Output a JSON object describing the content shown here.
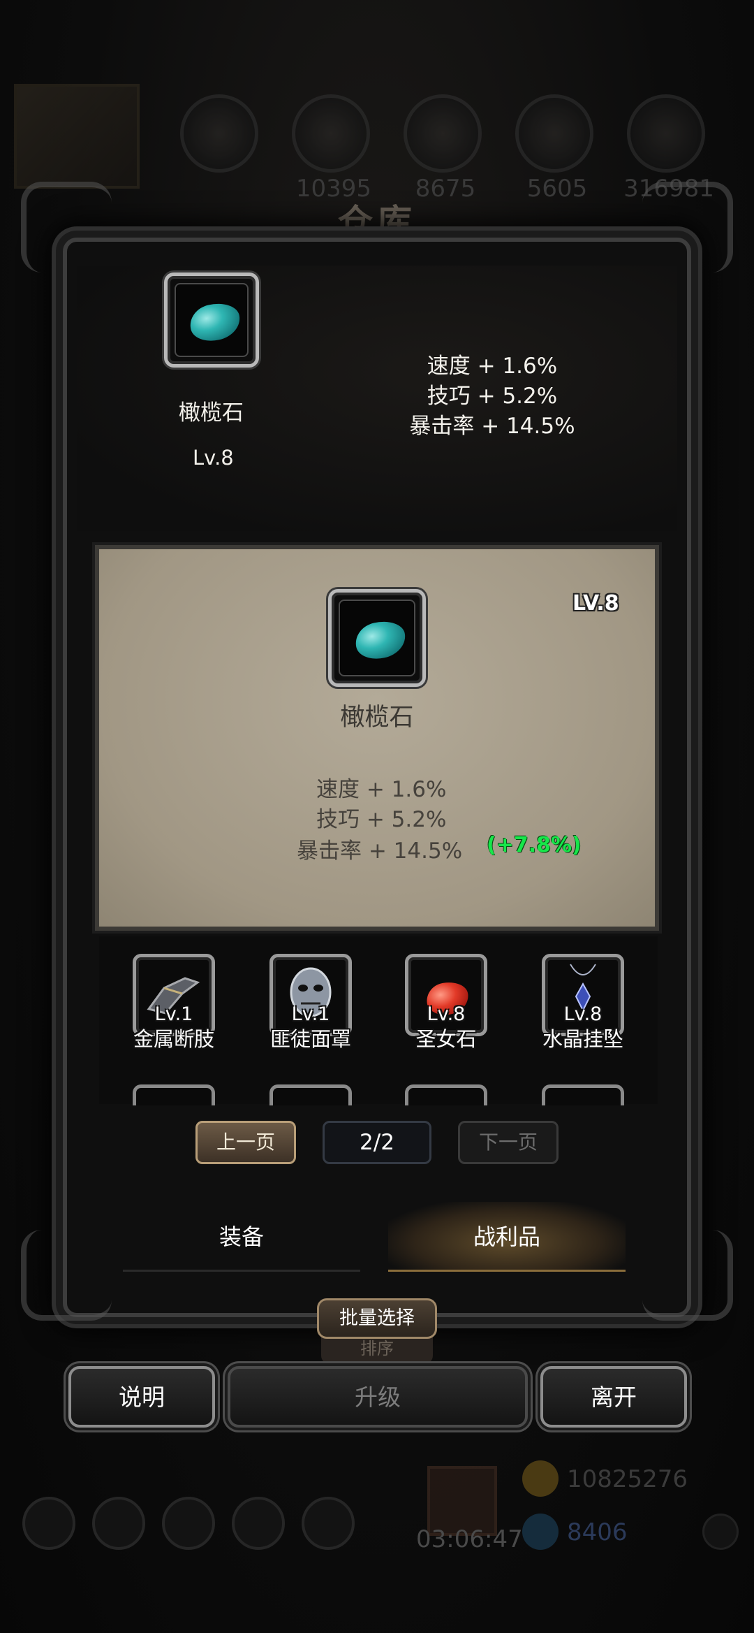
{
  "background": {
    "title": "仓库",
    "top_resources": [
      "10395",
      "8675",
      "5605",
      "316981"
    ],
    "gold": "10825276",
    "gems": "8406",
    "timer": "03:06:47"
  },
  "selected_item": {
    "name": "橄榄石",
    "level": "Lv.8",
    "stats": [
      "速度 + 1.6%",
      "技巧 + 5.2%",
      "暴击率 + 14.5%"
    ]
  },
  "compare_card": {
    "level": "LV.8",
    "name": "橄榄石",
    "stats": [
      "速度 + 1.6%",
      "技巧 + 5.2%",
      "暴击率 + 14.5%"
    ],
    "diff": "(+7.8%)"
  },
  "inventory": [
    {
      "name": "金属断肢",
      "level": "Lv.1",
      "icon": "metal-limb-icon"
    },
    {
      "name": "匪徒面罩",
      "level": "Lv.1",
      "icon": "bandit-mask-icon"
    },
    {
      "name": "圣女石",
      "level": "Lv.8",
      "icon": "red-gem-icon"
    },
    {
      "name": "水晶挂坠",
      "level": "Lv.8",
      "icon": "crystal-pendant-icon"
    }
  ],
  "pager": {
    "prev": "上一页",
    "page": "2/2",
    "next": "下一页"
  },
  "tabs": {
    "equipment": "装备",
    "loot": "战利品"
  },
  "actions": {
    "batch_select": "批量选择",
    "sort": "排序",
    "help": "说明",
    "upgrade": "升级",
    "leave": "离开"
  },
  "colors": {
    "parchment": "#a59c8b",
    "diff_green": "#17e64a",
    "gem_cyan": "#2fb6b3"
  }
}
